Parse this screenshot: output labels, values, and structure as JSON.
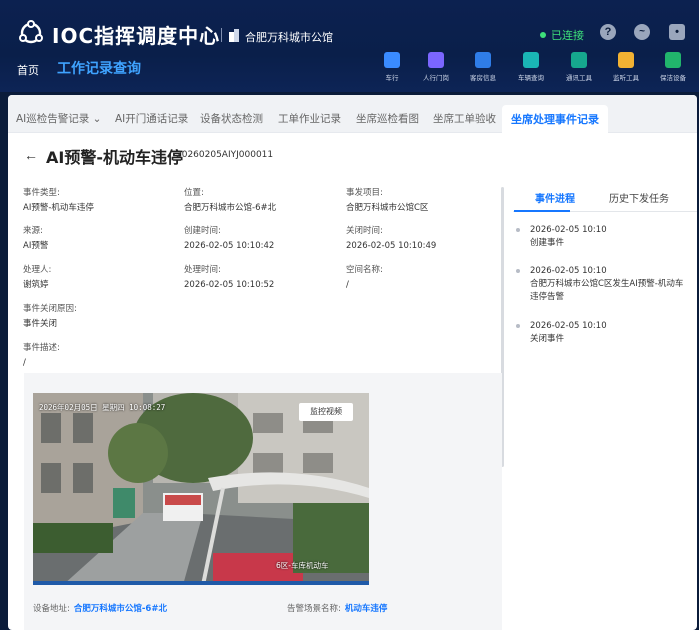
{
  "header": {
    "app_title": "IOC指挥调度中心",
    "site_name": "合肥万科城市公馆",
    "connection_status": "已连接",
    "status_color": "#3ee07a",
    "icons": [
      "help-icon",
      "heartbeat-icon",
      "user-icon"
    ]
  },
  "nav": {
    "home": "首页",
    "active": "工作记录查询"
  },
  "toolbar": [
    {
      "label": "车行",
      "icon": "car-icon",
      "color": "#3a8bff"
    },
    {
      "label": "人行门岗",
      "icon": "gate-icon",
      "color": "#7b66ff"
    },
    {
      "label": "客房信息",
      "icon": "house-icon",
      "color": "#2f7de8"
    },
    {
      "label": "车辆查询",
      "icon": "vehicle-search-icon",
      "color": "#1ab5b5"
    },
    {
      "label": "通讯工具",
      "icon": "phone-icon",
      "color": "#16a88e"
    },
    {
      "label": "监听工具",
      "icon": "monitor-icon",
      "color": "#f2b233"
    },
    {
      "label": "保洁设备",
      "icon": "cleaning-icon",
      "color": "#21b56c"
    }
  ],
  "tabs": [
    {
      "label": "AI巡检告警记录"
    },
    {
      "label": "AI开门通话记录"
    },
    {
      "label": "设备状态检测"
    },
    {
      "label": "工单作业记录"
    },
    {
      "label": "坐席巡检看图"
    },
    {
      "label": "坐席工单验收"
    },
    {
      "label": "坐席处理事件记录"
    }
  ],
  "page": {
    "title": "AI预警-机动车违停",
    "code": "20260205AIYJ000011"
  },
  "fields": {
    "event_type": {
      "label": "事件类型:",
      "value": "AI预警-机动车违停"
    },
    "location": {
      "label": "位置:",
      "value": "合肥万科城市公馆-6#北"
    },
    "project": {
      "label": "事发项目:",
      "value": "合肥万科城市公馆C区"
    },
    "source": {
      "label": "来源:",
      "value": "AI预警"
    },
    "created": {
      "label": "创建时间:",
      "value": "2026-02-05 10:10:42"
    },
    "closed": {
      "label": "关闭时间:",
      "value": "2026-02-05 10:10:49"
    },
    "handler": {
      "label": "处理人:",
      "value": "谢筑婷"
    },
    "handled": {
      "label": "处理时间:",
      "value": "2026-02-05 10:10:52"
    },
    "space": {
      "label": "空间名称:",
      "value": "/"
    },
    "close_reason": {
      "label": "事件关闭原因:",
      "value": "事件关闭"
    },
    "description": {
      "label": "事件描述:",
      "value": "/"
    }
  },
  "right_tabs": {
    "progress": "事件进程",
    "history": "历史下发任务"
  },
  "timeline": [
    {
      "time": "2026-02-05 10:10",
      "text": "创建事件"
    },
    {
      "time": "2026-02-05 10:10",
      "text": "合肥万科城市公馆C区发生AI预警-机动车违停告警"
    },
    {
      "time": "2026-02-05 10:10",
      "text": "关闭事件"
    }
  ],
  "video": {
    "button": "监控视频",
    "timestamp": "2026年02月05日 星期四 10:08:27",
    "camera_label": "6区-车库机动车"
  },
  "device_info": {
    "address_label": "设备地址:",
    "address_value": "合肥万科城市公馆-6#北",
    "scene_label": "告警场景名称:",
    "scene_value": "机动车违停"
  }
}
